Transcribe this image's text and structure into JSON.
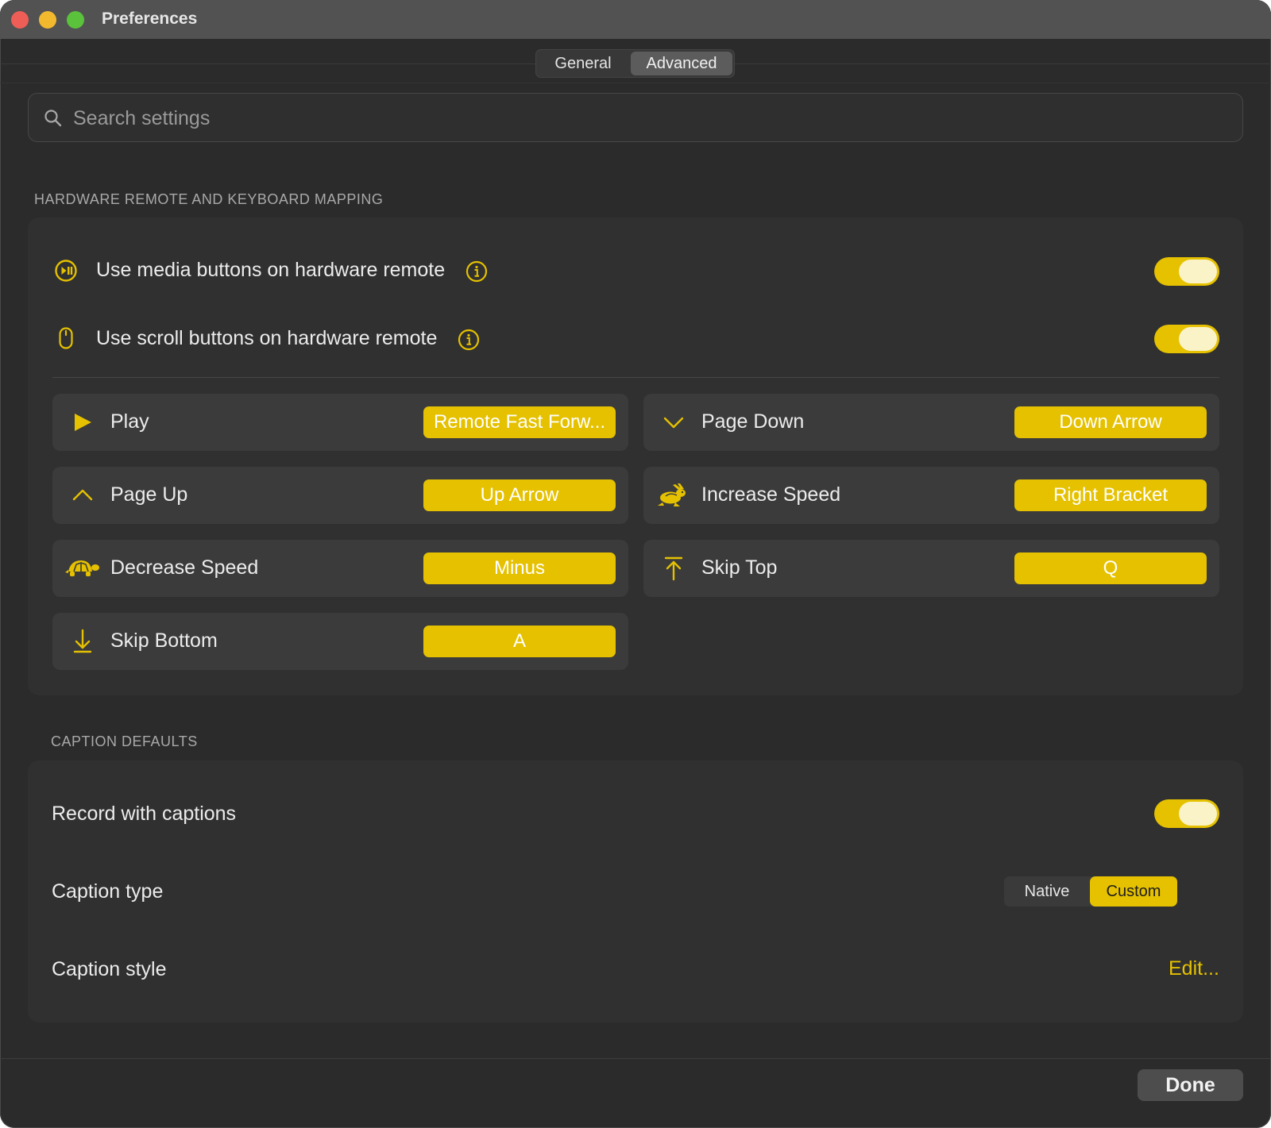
{
  "window": {
    "title": "Preferences"
  },
  "tabs": [
    {
      "label": "General",
      "selected": false
    },
    {
      "label": "Advanced",
      "selected": true
    }
  ],
  "search": {
    "placeholder": "Search settings",
    "value": ""
  },
  "hardware": {
    "section_title": "HARDWARE REMOTE AND KEYBOARD MAPPING",
    "toggles": [
      {
        "label": "Use media buttons on hardware remote",
        "icon": "play-pause-icon",
        "on": true
      },
      {
        "label": "Use scroll buttons on hardware remote",
        "icon": "mouse-icon",
        "on": true
      }
    ],
    "mappings": [
      {
        "label": "Play",
        "key": "Remote Fast Forw...",
        "icon": "play-icon"
      },
      {
        "label": "Page Down",
        "key": "Down Arrow",
        "icon": "chevron-down-icon"
      },
      {
        "label": "Page Up",
        "key": "Up Arrow",
        "icon": "chevron-up-icon"
      },
      {
        "label": "Increase Speed",
        "key": "Right Bracket",
        "icon": "rabbit-icon"
      },
      {
        "label": "Decrease Speed",
        "key": "Minus",
        "icon": "turtle-icon"
      },
      {
        "label": "Skip Top",
        "key": "Q",
        "icon": "arrow-to-top-icon"
      },
      {
        "label": "Skip Bottom",
        "key": "A",
        "icon": "arrow-to-bottom-icon"
      }
    ]
  },
  "captions": {
    "section_title": "CAPTION DEFAULTS",
    "record_label": "Record with captions",
    "record_on": true,
    "type_label": "Caption type",
    "type_options": [
      "Native",
      "Custom"
    ],
    "type_selected": "Custom",
    "style_label": "Caption style",
    "style_action": "Edit..."
  },
  "footer": {
    "done_label": "Done"
  },
  "colors": {
    "accent": "#e5c100",
    "background": "#2b2b2b",
    "panel": "#303030"
  }
}
